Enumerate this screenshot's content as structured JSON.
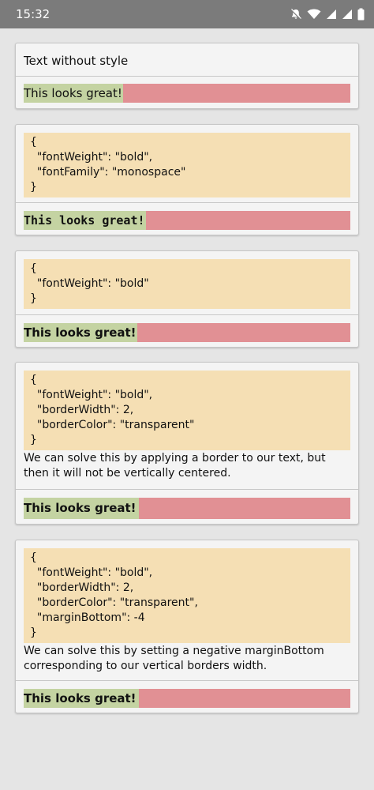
{
  "status_bar": {
    "time": "15:32",
    "icons": [
      "notifications-off-icon",
      "wifi-icon",
      "signal-icon",
      "signal-icon-2",
      "battery-icon"
    ]
  },
  "demo_text": "This looks great!",
  "colors": {
    "background": "#e5e5e5",
    "status_bar": "#7b7b7b",
    "code_background": "#f5dfb4",
    "text_highlight": "#c4d3a2",
    "container_fill": "#e19094"
  },
  "cards": [
    {
      "title": "Text without style",
      "demo": "This looks great!"
    },
    {
      "code": "{\n  \"fontWeight\": \"bold\",\n  \"fontFamily\": \"monospace\"\n}",
      "demo": "This looks great!"
    },
    {
      "code": "{\n  \"fontWeight\": \"bold\"\n}",
      "demo": "This looks great!"
    },
    {
      "code": "{\n  \"fontWeight\": \"bold\",\n  \"borderWidth\": 2,\n  \"borderColor\": \"transparent\"\n}",
      "description": "We can solve this by applying a border to our text, but then it will not be vertically centered.",
      "demo": "This looks great!"
    },
    {
      "code": "{\n  \"fontWeight\": \"bold\",\n  \"borderWidth\": 2,\n  \"borderColor\": \"transparent\",\n  \"marginBottom\": -4\n}",
      "description": "We can solve this by setting a negative marginBottom corresponding to our vertical borders width.",
      "demo": "This looks great!"
    }
  ]
}
